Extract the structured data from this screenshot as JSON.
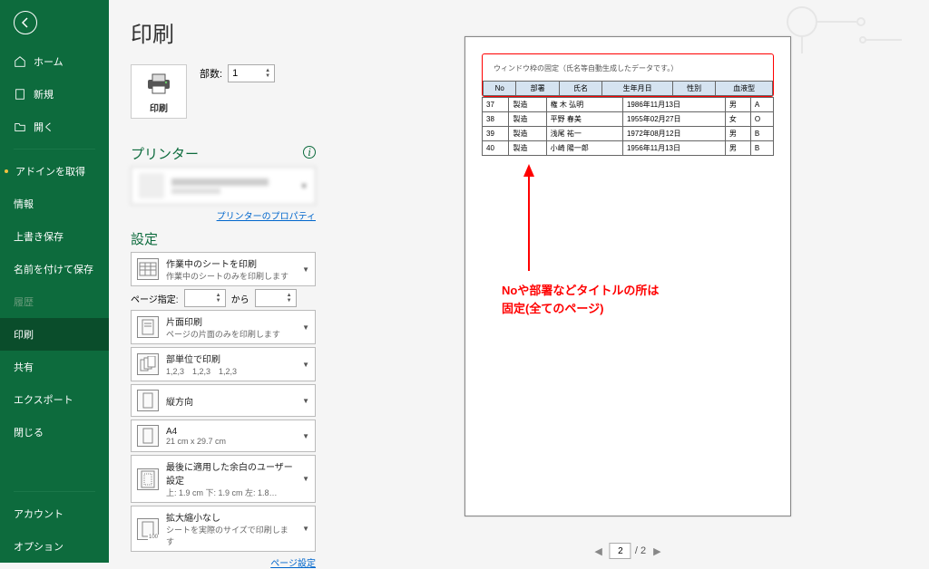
{
  "page_title": "印刷",
  "sidebar": {
    "home": "ホーム",
    "new": "新規",
    "open": "開く",
    "addin": "アドインを取得",
    "info": "情報",
    "save": "上書き保存",
    "saveas": "名前を付けて保存",
    "history": "履歴",
    "print": "印刷",
    "share": "共有",
    "export": "エクスポート",
    "close": "閉じる",
    "account": "アカウント",
    "options": "オプション"
  },
  "print_button": "印刷",
  "copies_label": "部数:",
  "copies_value": "1",
  "printer_heading": "プリンター",
  "printer_properties_link": "プリンターのプロパティ",
  "settings_heading": "設定",
  "settings": {
    "active_sheets": {
      "title": "作業中のシートを印刷",
      "sub": "作業中のシートのみを印刷します"
    },
    "page_from_label": "ページ指定:",
    "page_to_label": "から",
    "single_side": {
      "title": "片面印刷",
      "sub": "ページの片面のみを印刷します"
    },
    "collated": {
      "title": "部単位で印刷",
      "sub": "1,2,3　1,2,3　1,2,3"
    },
    "portrait": {
      "title": "縦方向",
      "sub": ""
    },
    "paper": {
      "title": "A4",
      "sub": "21 cm x 29.7 cm"
    },
    "margins": {
      "title": "最後に適用した余白のユーザー設定",
      "sub": "上: 1.9 cm 下: 1.9 cm 左: 1.8…"
    },
    "scaling": {
      "title": "拡大縮小なし",
      "sub": "シートを実際のサイズで印刷します"
    },
    "scaling_badge": "100"
  },
  "page_setup_link": "ページ設定",
  "preview": {
    "doc_title": "ウィンドウ枠の固定（氏名等自動生成したデータです。）",
    "headers": [
      "No",
      "部署",
      "氏名",
      "生年月日",
      "性別",
      "血液型"
    ],
    "rows": [
      [
        "37",
        "製造",
        "権 木 弘明",
        "1986年11月13日",
        "男",
        "A"
      ],
      [
        "38",
        "製造",
        "平野 春美",
        "1955年02月27日",
        "女",
        "O"
      ],
      [
        "39",
        "製造",
        "浅尾 祐一",
        "1972年08月12日",
        "男",
        "B"
      ],
      [
        "40",
        "製造",
        "小崎 陽一郎",
        "1956年11月13日",
        "男",
        "B"
      ]
    ]
  },
  "annotation_line1": "Noや部署などタイトルの所は",
  "annotation_line2": "固定(全てのページ)",
  "page_nav": {
    "current": "2",
    "total": "2"
  }
}
